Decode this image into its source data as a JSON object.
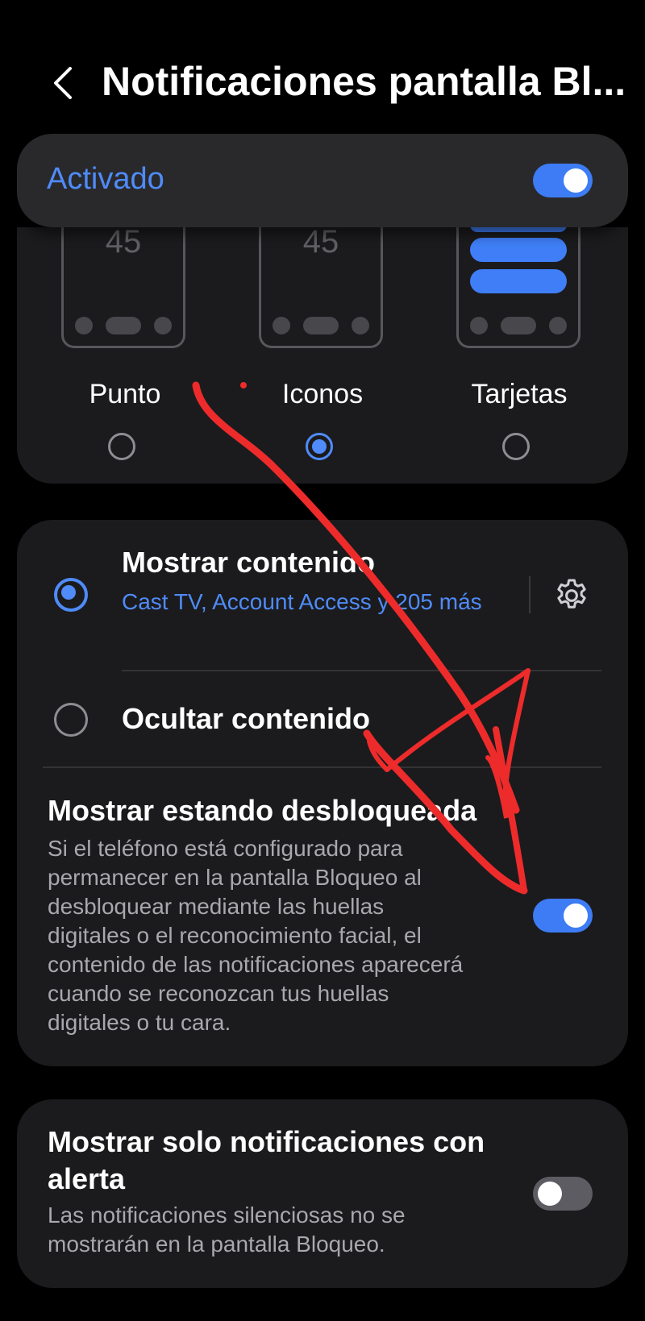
{
  "header": {
    "back_icon": "chevron-left-icon",
    "title": "Notificaciones pantalla Bl..."
  },
  "master": {
    "label": "Activado",
    "enabled": true
  },
  "style": {
    "preview_time": "45",
    "options": [
      {
        "label": "Punto",
        "selected": false
      },
      {
        "label": "Iconos",
        "selected": true
      },
      {
        "label": "Tarjetas",
        "selected": false
      }
    ]
  },
  "content": {
    "show": {
      "title": "Mostrar contenido",
      "subtitle": " Cast TV, Account Access y 205 más",
      "selected": true,
      "settings_icon": "gear-icon"
    },
    "hide": {
      "title": "Ocultar contenido",
      "selected": false
    },
    "unlocked": {
      "title": "Mostrar estando desbloqueada",
      "description": "Si el teléfono está configurado para permanecer en la pantalla Bloqueo al desbloquear mediante las huellas digitales o el reconocimiento facial, el contenido de las notificaciones aparecerá cuando se reconozcan tus huellas digitales o tu cara.",
      "enabled": true
    }
  },
  "alert_only": {
    "title": "Mostrar solo notificaciones con alerta",
    "description": "Las notificaciones silenciosas no se mostrarán en la pantalla Bloqueo.",
    "enabled": false
  },
  "colors": {
    "accent": "#4f8bf9",
    "background": "#000000",
    "card": "#1b1b1d",
    "annotation": "#ee2b2b"
  }
}
